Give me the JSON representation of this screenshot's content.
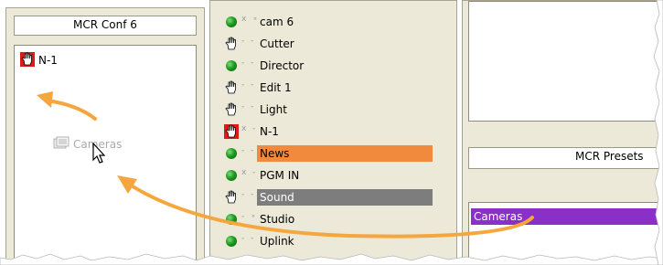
{
  "left_panel": {
    "title": "MCR Conf 6",
    "item": "N-1",
    "ghost_label": "Cameras"
  },
  "source_list": [
    {
      "name": "cam 6",
      "type": "dot",
      "flags": "x ∘"
    },
    {
      "name": "Cutter",
      "type": "hand",
      "flags": "- -"
    },
    {
      "name": "Director",
      "type": "dot",
      "flags": "- -"
    },
    {
      "name": "Edit 1",
      "type": "hand",
      "flags": "- -"
    },
    {
      "name": "Light",
      "type": "hand",
      "flags": "- -"
    },
    {
      "name": "N-1",
      "type": "hand-red",
      "flags": "x -"
    },
    {
      "name": "News",
      "type": "dot",
      "flags": "- -",
      "highlight": "orange"
    },
    {
      "name": "PGM IN",
      "type": "dot",
      "flags": "x -"
    },
    {
      "name": "Sound",
      "type": "hand",
      "flags": "- -",
      "highlight": "gray"
    },
    {
      "name": "Studio",
      "type": "dot",
      "flags": "- ∘"
    },
    {
      "name": "Uplink",
      "type": "dot",
      "flags": "- -"
    }
  ],
  "presets_panel": {
    "title": "MCR Presets",
    "item": "Cameras"
  },
  "colors": {
    "panel_bg": "#ece9d8",
    "highlight_orange": "#f28a3e",
    "highlight_gray": "#7d7d7d",
    "preset_selected": "#8a2fc8",
    "arrow": "#f5a63c",
    "status_green": "#1f9a1f",
    "alert_red": "#e01818"
  }
}
